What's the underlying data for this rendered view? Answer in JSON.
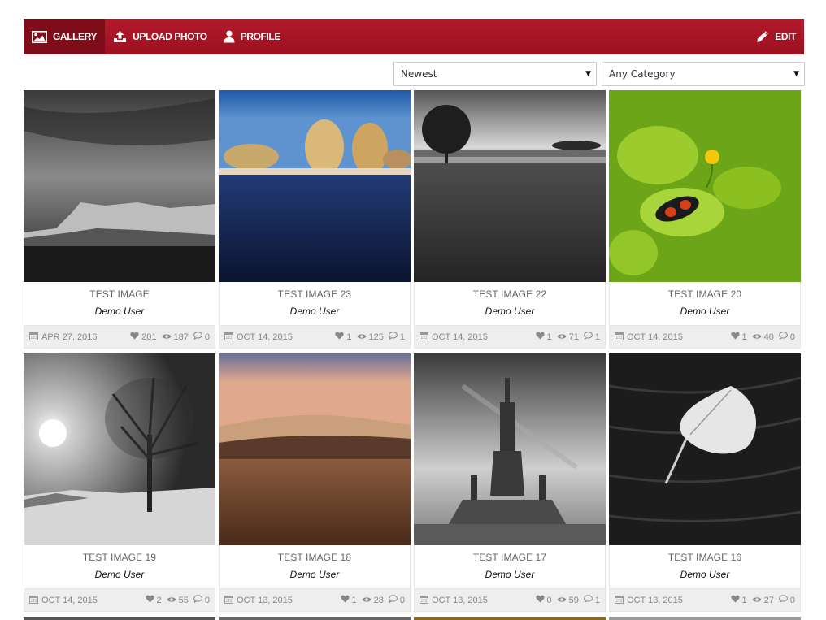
{
  "nav": {
    "gallery": "GALLERY",
    "upload": "UPLOAD PHOTO",
    "profile": "PROFILE",
    "edit": "EDIT"
  },
  "filters": {
    "sort": "Newest",
    "category": "Any Category"
  },
  "photos": [
    {
      "title": "TEST IMAGE",
      "author": "Demo User",
      "date": "APR 27, 2016",
      "likes": "201",
      "views": "187",
      "comments": "0"
    },
    {
      "title": "TEST IMAGE 23",
      "author": "Demo User",
      "date": "OCT 14, 2015",
      "likes": "1",
      "views": "125",
      "comments": "1"
    },
    {
      "title": "TEST IMAGE 22",
      "author": "Demo User",
      "date": "OCT 14, 2015",
      "likes": "1",
      "views": "71",
      "comments": "1"
    },
    {
      "title": "TEST IMAGE 20",
      "author": "Demo User",
      "date": "OCT 14, 2015",
      "likes": "1",
      "views": "40",
      "comments": "0"
    },
    {
      "title": "TEST IMAGE 19",
      "author": "Demo User",
      "date": "OCT 14, 2015",
      "likes": "2",
      "views": "55",
      "comments": "0"
    },
    {
      "title": "TEST IMAGE 18",
      "author": "Demo User",
      "date": "OCT 13, 2015",
      "likes": "1",
      "views": "28",
      "comments": "0"
    },
    {
      "title": "TEST IMAGE 17",
      "author": "Demo User",
      "date": "OCT 13, 2015",
      "likes": "0",
      "views": "59",
      "comments": "1"
    },
    {
      "title": "TEST IMAGE 16",
      "author": "Demo User",
      "date": "OCT 13, 2015",
      "likes": "1",
      "views": "27",
      "comments": "0"
    }
  ],
  "colors": {
    "brand": "#a8141f",
    "brand_active": "#7e0d19",
    "meta_bg": "#eeeeee"
  },
  "icons": {
    "gallery": "image-icon",
    "upload": "upload-icon",
    "profile": "user-icon",
    "edit": "pencil-icon",
    "date": "calendar-icon",
    "likes": "heart-icon",
    "views": "eye-icon",
    "comments": "comment-icon"
  }
}
